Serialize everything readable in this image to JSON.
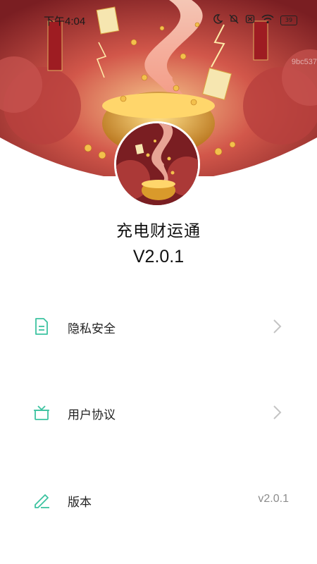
{
  "status_bar": {
    "time": "下午4:04",
    "battery": "39"
  },
  "hero": {
    "watermark": "9bc537"
  },
  "app": {
    "name": "充电财运通",
    "version": "V2.0.1"
  },
  "menu": [
    {
      "label": "隐私安全",
      "icon": "document-icon",
      "action": "chevron-right-icon"
    },
    {
      "label": "用户协议",
      "icon": "gift-box-icon",
      "action": "chevron-right-icon"
    },
    {
      "label": "版本",
      "icon": "pencil-icon",
      "value": "v2.0.1"
    }
  ],
  "colors": {
    "accent": "#3cc3a0",
    "chevron": "#c4c4c4",
    "value_text": "#8c8c8c"
  }
}
